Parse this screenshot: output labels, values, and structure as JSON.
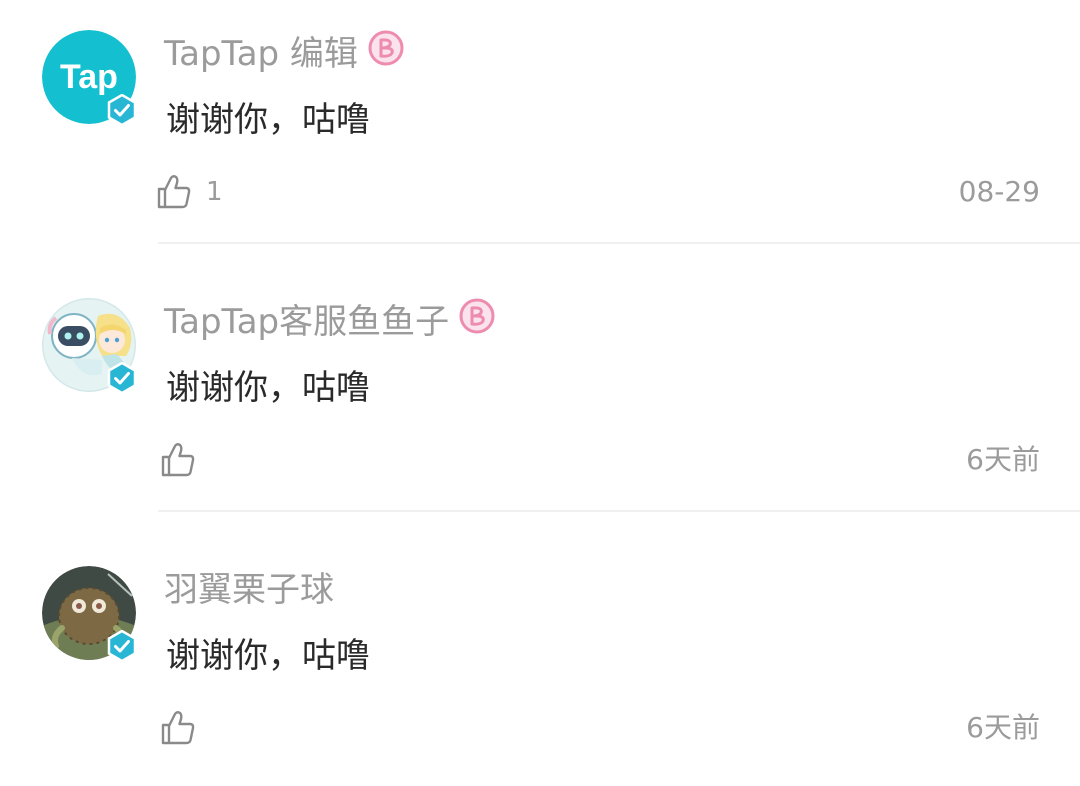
{
  "comments": [
    {
      "user": "TapTap 编辑",
      "text": "谢谢你，咕噜",
      "likes": "1",
      "time": "08-29",
      "avatar": "taptap-logo",
      "verified": true,
      "badge": "pink-b-badge"
    },
    {
      "user": "TapTap客服鱼鱼子",
      "text": "谢谢你，咕噜",
      "likes": "",
      "time": "6天前",
      "avatar": "anime-robot-girl-avatar",
      "verified": true,
      "badge": "pink-b-badge"
    },
    {
      "user": "羽翼栗子球",
      "text": "谢谢你，咕噜",
      "likes": "",
      "time": "6天前",
      "avatar": "kuriboh-avatar",
      "verified": true,
      "badge": ""
    }
  ],
  "colors": {
    "brand": "#14c0d0",
    "verified": "#27b6d4",
    "badge": "#ee8cb0",
    "muted_text": "#9b9b9b",
    "body_text": "#2a2a2a",
    "divider": "#f0f0f0"
  },
  "logo_text": "Tap"
}
